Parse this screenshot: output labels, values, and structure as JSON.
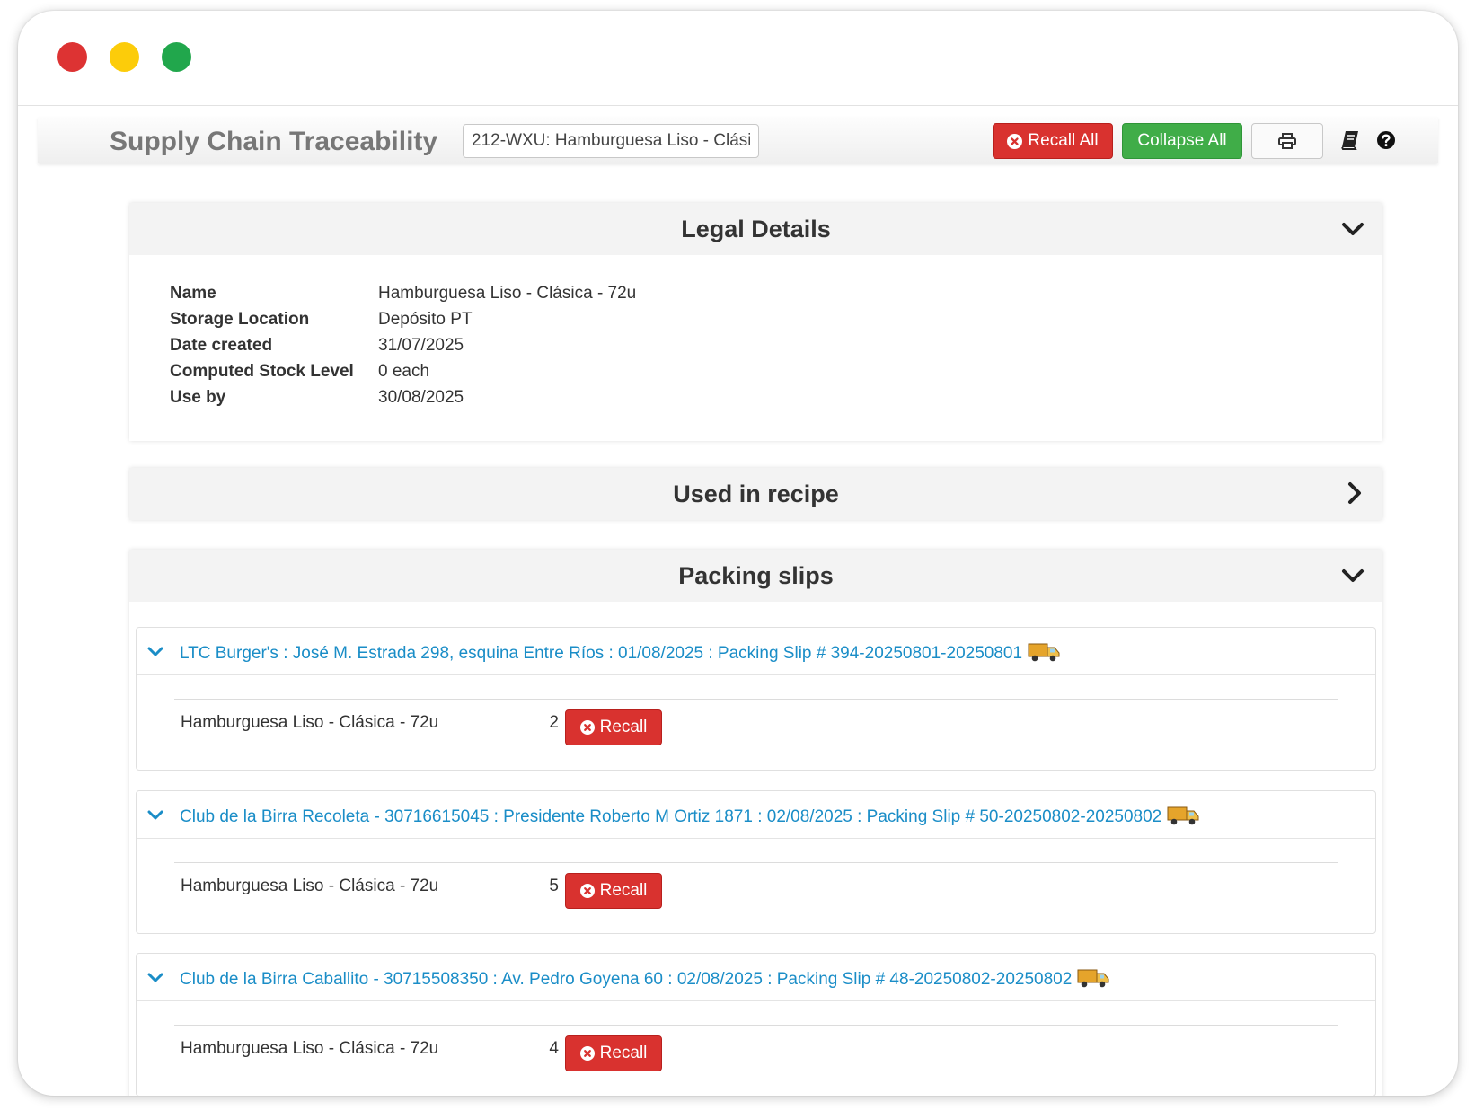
{
  "toolbar": {
    "title": "Supply Chain Traceability",
    "search_value": "212-WXU: Hamburguesa Liso - Clási",
    "recall_all_label": "Recall All",
    "collapse_all_label": "Collapse All",
    "print_icon": "print-icon",
    "book_icon": "book-icon",
    "help_icon": "question-circle-icon"
  },
  "legal": {
    "title": "Legal Details",
    "rows": [
      {
        "label": "Name",
        "value": "Hamburguesa Liso - Clásica - 72u"
      },
      {
        "label": "Storage Location",
        "value": "Depósito PT"
      },
      {
        "label": "Date created",
        "value": "31/07/2025"
      },
      {
        "label": "Computed Stock Level",
        "value": "0 each"
      },
      {
        "label": "Use by",
        "value": "30/08/2025"
      }
    ]
  },
  "recipe": {
    "title": "Used in recipe"
  },
  "packing": {
    "title": "Packing slips",
    "recall_label": "Recall",
    "slips": [
      {
        "header": "LTC Burger's : José M. Estrada 298, esquina Entre Ríos : 01/08/2025 : Packing Slip # 394-20250801-20250801",
        "item": "Hamburguesa Liso - Clásica - 72u",
        "qty": "2"
      },
      {
        "header": "Club de la Birra Recoleta - 30716615045 : Presidente Roberto M Ortiz 1871 : 02/08/2025 : Packing Slip # 50-20250802-20250802",
        "item": "Hamburguesa Liso - Clásica - 72u",
        "qty": "5"
      },
      {
        "header": "Club de la Birra Caballito - 30715508350 : Av. Pedro Goyena 60 : 02/08/2025 : Packing Slip # 48-20250802-20250802",
        "item": "Hamburguesa Liso - Clásica - 72u",
        "qty": "4"
      }
    ]
  },
  "colors": {
    "recall_red": "#d9322f",
    "collapse_green": "#40ad48",
    "link_blue": "#1a8dc7"
  }
}
